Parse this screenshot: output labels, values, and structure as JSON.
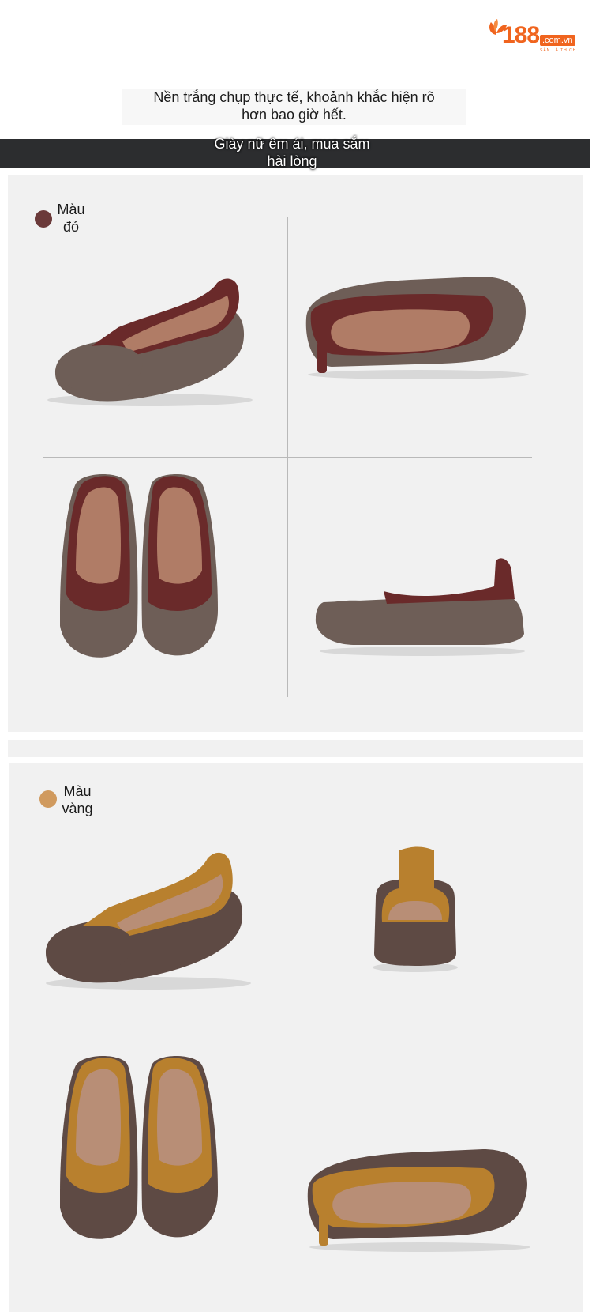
{
  "logo": {
    "number": "188",
    "domain": ".com.vn",
    "tagline": "SĂN LÀ THÍCH"
  },
  "headline": {
    "line1": "Nền trắng chụp thực tế, khoảnh khắc hiện rõ",
    "line2": "hơn bao giờ hết."
  },
  "banner": {
    "line1": "Giày nữ êm ái, mua sắm",
    "line2": "hài lòng"
  },
  "variants": [
    {
      "label_line1": "Màu",
      "label_line2": "đỏ",
      "swatch_color": "#6b3a3a",
      "upper_color": "#6a2a2a",
      "sole_color": "#6e5e57",
      "lining_color": "#b07c66"
    },
    {
      "label_line1": "Màu",
      "label_line2": "vàng",
      "swatch_color": "#d09a5e",
      "upper_color": "#b8802e",
      "sole_color": "#5e4a44",
      "lining_color": "#b88e76"
    }
  ],
  "colors": {
    "banner_bg": "#2c2d2f",
    "panel_bg": "#f1f1f1",
    "brand_orange": "#f0641e"
  }
}
